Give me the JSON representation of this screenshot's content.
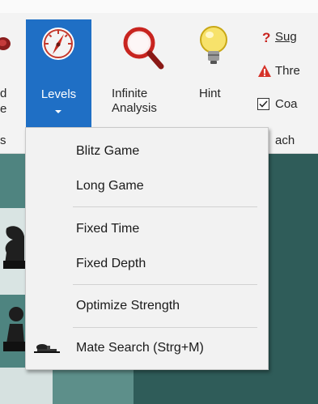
{
  "ribbon": {
    "left_partial_label_1": "d",
    "left_partial_label_2": "e",
    "left_partial_group": "s",
    "levels_label": "Levels",
    "infinite_line1": "Infinite",
    "infinite_line2": "Analysis",
    "hint_label": "Hint",
    "suggest_label": "Sug",
    "threat_label": "Thre",
    "coach_label": "Coa",
    "coach_group_label": "ach"
  },
  "levels_menu": {
    "items": [
      {
        "label": "Blitz Game"
      },
      {
        "label": "Long Game"
      },
      {
        "label": "Fixed Time"
      },
      {
        "label": "Fixed Depth"
      },
      {
        "label": "Optimize Strength"
      },
      {
        "label": "Mate Search (Strg+M)"
      }
    ]
  },
  "colors": {
    "accent_pressed": "#1f6fc5",
    "board_dark": "#2f5c59",
    "board_light": "#5b8d88"
  }
}
